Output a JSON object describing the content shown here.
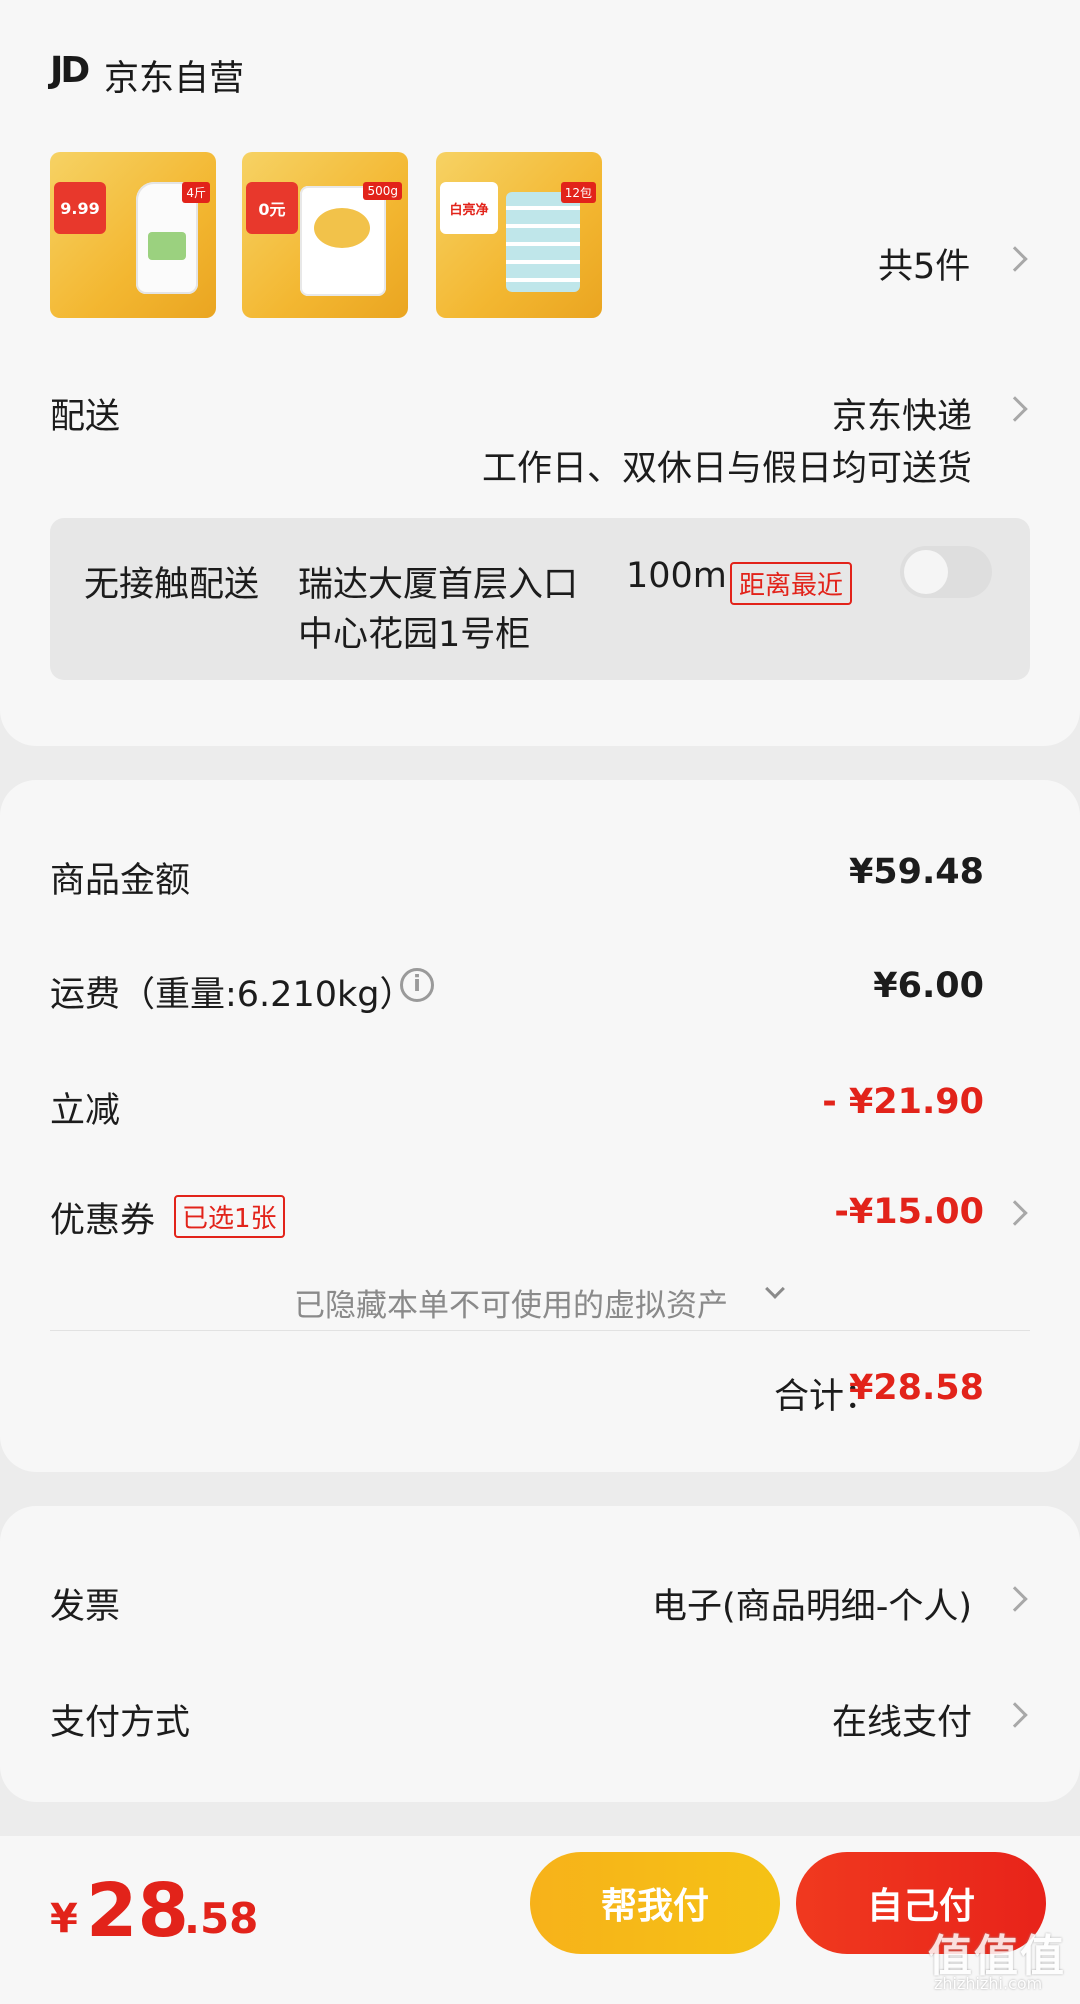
{
  "shop": {
    "logo": "JD",
    "name": "京东自营"
  },
  "products": {
    "count_label": "共5件",
    "items": [
      {
        "badge": "4斤",
        "tag": "9.99"
      },
      {
        "badge": "500g",
        "tag": "0元"
      },
      {
        "badge": "12包",
        "tag": "白亮净"
      }
    ]
  },
  "delivery": {
    "label": "配送",
    "carrier": "京东快递",
    "schedule": "工作日、双休日与假日均可送货"
  },
  "contactless": {
    "label": "无接触配送",
    "location_line1": "瑞达大厦首层入口",
    "location_line2": "中心花园1号柜",
    "distance": "100m",
    "tag": "距离最近"
  },
  "summary": {
    "goods_label": "商品金额",
    "goods_value": "¥59.48",
    "shipping_label": "运费（重量:6.210kg）",
    "shipping_value": "¥6.00",
    "discount_label": "立减",
    "discount_value": "- ¥21.90",
    "coupon_label": "优惠券",
    "coupon_tag": "已选1张",
    "coupon_value": "-¥15.00",
    "hidden_hint": "已隐藏本单不可使用的虚拟资产",
    "total_label": "合计：",
    "total_value": "¥28.58"
  },
  "invoice": {
    "label": "发票",
    "value": "电子(商品明细-个人)"
  },
  "payment": {
    "label": "支付方式",
    "value": "在线支付"
  },
  "footer": {
    "currency": "¥",
    "price_int": "28",
    "price_dec": ".58",
    "help_pay": "帮我付",
    "self_pay": "自己付"
  },
  "watermark": {
    "text": "值值值",
    "sub": "zhizhizhi.com"
  },
  "colors": {
    "accent_red": "#e2231a",
    "accent_yellow": "#f7b21a"
  }
}
